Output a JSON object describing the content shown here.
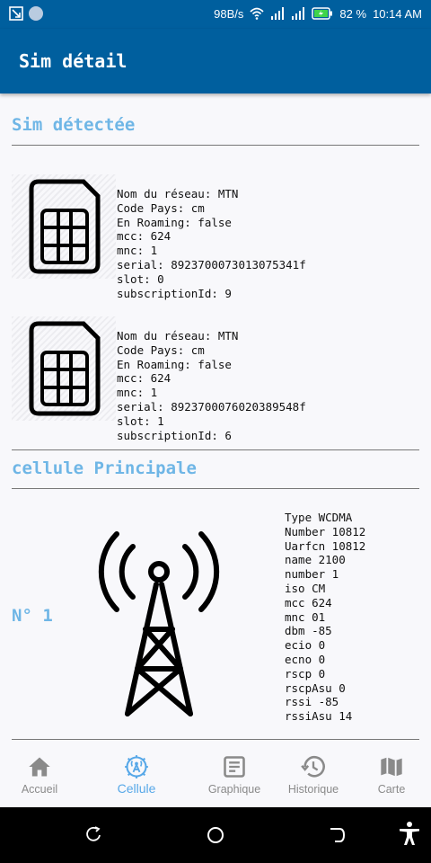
{
  "status_bar": {
    "network_speed": "98B/s",
    "battery": "82 %",
    "time": "10:14 AM",
    "icons": [
      "screenshot-icon",
      "notification-circle-icon",
      "wifi-icon",
      "signal-icon",
      "signal-icon",
      "battery-charging-icon"
    ]
  },
  "app_bar": {
    "title": "Sim détail"
  },
  "sim_section": {
    "title": "Sim détectée",
    "sims": [
      {
        "network_name": "Nom du réseau: MTN",
        "country_code": "Code Pays: cm",
        "roaming": "En Roaming: false",
        "mcc": "mcc: 624",
        "mnc": "mnc: 1",
        "serial": "serial: 8923700073013075341f",
        "slot": "slot: 0",
        "subscription_id": "subscriptionId: 9"
      },
      {
        "network_name": "Nom du réseau: MTN",
        "country_code": "Code Pays: cm",
        "roaming": "En Roaming: false",
        "mcc": "mcc: 624",
        "mnc": "mnc: 1",
        "serial": "serial: 8923700076020389548f",
        "slot": "slot: 1",
        "subscription_id": "subscriptionId: 6"
      }
    ]
  },
  "cell_section": {
    "title": "cellule Principale",
    "number_label": "N° 1",
    "info": {
      "type": "Type WCDMA",
      "number_full": "Number 10812",
      "uarfcn": "Uarfcn 10812",
      "name": "name 2100",
      "number": "number 1",
      "iso": "iso CM",
      "mcc": "mcc 624",
      "mnc": "mnc 01",
      "dbm": "dbm -85",
      "ecio": "ecio 0",
      "ecno": "ecno 0",
      "rscp": "rscp 0",
      "rscpasu": "rscpAsu 0",
      "rssi": "rssi -85",
      "rssiasu": "rssiAsu 14"
    }
  },
  "bottom_nav": {
    "items": [
      {
        "label": "Accueil",
        "icon": "home-icon"
      },
      {
        "label": "Cellule",
        "icon": "cell-icon",
        "active": true
      },
      {
        "label": "Graphique",
        "icon": "chart-icon"
      },
      {
        "label": "Historique",
        "icon": "history-icon"
      },
      {
        "label": "Carte",
        "icon": "map-icon"
      }
    ]
  },
  "colors": {
    "primary": "#005f9e",
    "accent": "#6fb6e6",
    "active_nav": "#57a8e8",
    "inactive_nav": "#8a8a8a"
  }
}
